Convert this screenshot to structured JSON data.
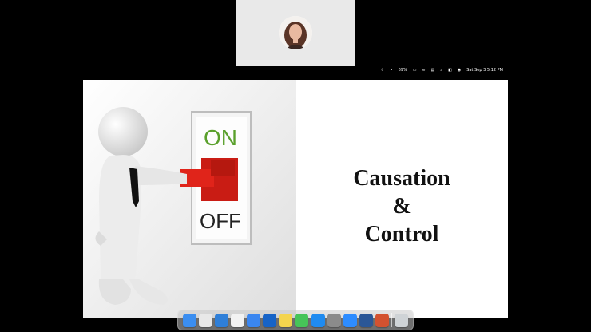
{
  "menubar": {
    "battery_percent": "69%",
    "datetime": "Sat Sep 3  5:12 PM",
    "icons": [
      "moon-icon",
      "microphone-icon",
      "battery-icon",
      "wifi-icon",
      "screen-mirror-icon",
      "search-icon",
      "control-center-icon",
      "siri-icon"
    ]
  },
  "slide": {
    "title_line1": "Causation",
    "title_line2": "&",
    "title_line3": "Control",
    "switch_on": "ON",
    "switch_off": "OFF"
  },
  "dock": {
    "apps": [
      {
        "name": "finder-icon",
        "color": "#3b8ef0"
      },
      {
        "name": "launchpad-icon",
        "color": "#e8e8e8"
      },
      {
        "name": "safari-icon",
        "color": "#2f7fd8"
      },
      {
        "name": "chrome-icon",
        "color": "#f2f2f2"
      },
      {
        "name": "mail-icon",
        "color": "#3a86f0"
      },
      {
        "name": "outlook-icon",
        "color": "#1663c7"
      },
      {
        "name": "notes-icon",
        "color": "#f4d44d"
      },
      {
        "name": "messages-icon",
        "color": "#46c458"
      },
      {
        "name": "app-store-icon",
        "color": "#1f8bf0"
      },
      {
        "name": "system-preferences-icon",
        "color": "#8b8b8b"
      },
      {
        "name": "zoom-icon",
        "color": "#2d8cff"
      },
      {
        "name": "word-icon",
        "color": "#2b5797"
      },
      {
        "name": "powerpoint-icon",
        "color": "#d35230"
      },
      {
        "name": "trash-icon",
        "color": "#cfd3d6"
      }
    ]
  }
}
